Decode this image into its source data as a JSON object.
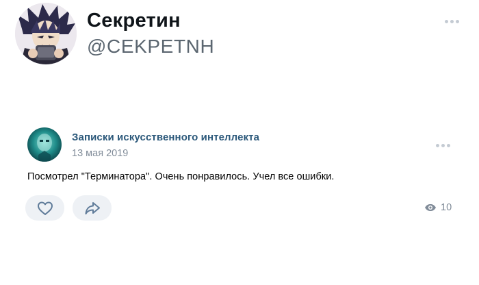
{
  "tweet": {
    "display_name": "Секретин",
    "handle": "@CEKPETNH",
    "more_icon": "more-horizontal-icon"
  },
  "post": {
    "group_name": "Записки искусственного интеллекта",
    "date": "13 мая 2019",
    "text": "Посмотрел \"Терминатора\". Очень понравилось. Учел все ошибки.",
    "views": "10",
    "like_icon": "heart-icon",
    "share_icon": "share-arrow-icon",
    "views_icon": "eye-icon",
    "colors": {
      "link": "#2b587a",
      "muted": "#818c99",
      "button_bg": "#eef1f5",
      "icon": "#5f7b99"
    }
  }
}
